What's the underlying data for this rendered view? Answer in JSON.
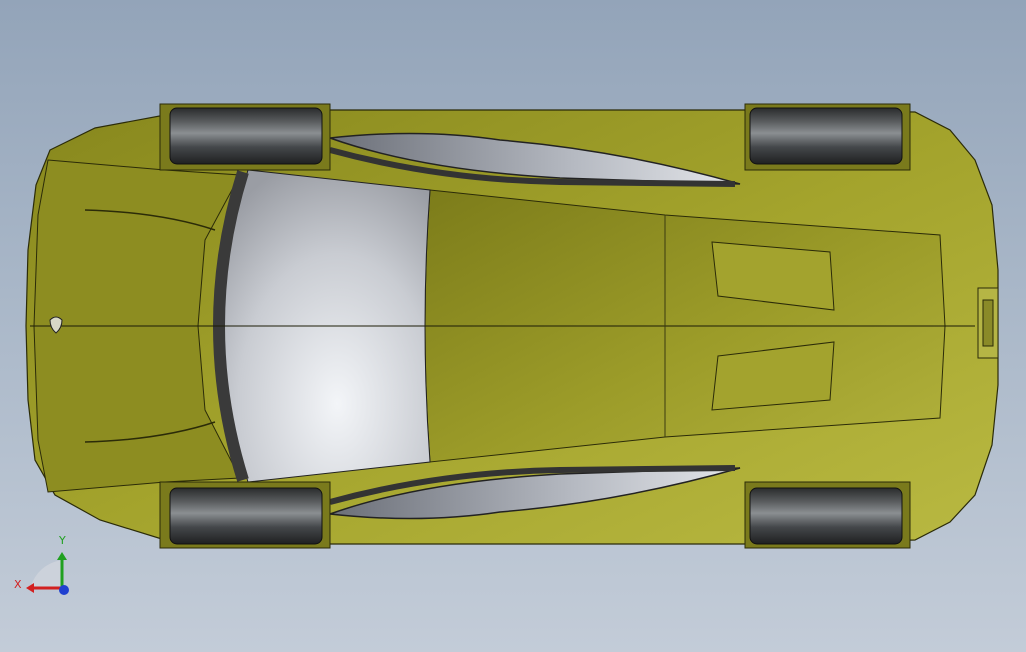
{
  "viewport": {
    "background_top": "#93a4b9",
    "background_bottom": "#c3ccd8"
  },
  "model": {
    "view": "top",
    "body_color": "#a6a62a",
    "glass_color": "#e3e6ea",
    "tire_color": "#3b3d3e"
  },
  "triad": {
    "x_label": "X",
    "y_label": "Y",
    "x_color": "#d22020",
    "y_color": "#20a020",
    "z_color": "#2040d0"
  }
}
